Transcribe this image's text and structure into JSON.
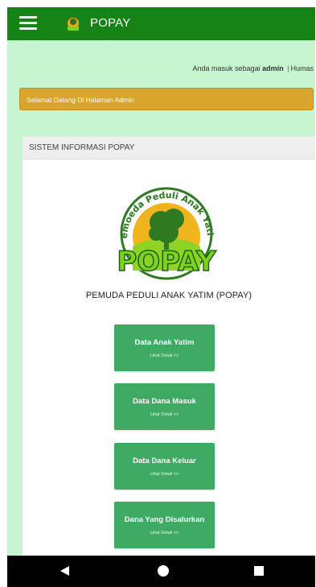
{
  "header": {
    "title": "POPAY",
    "menu_icon": "hamburger-icon",
    "logo_icon": "popay-logo-icon"
  },
  "login": {
    "prefix": "Anda masuk sebagai",
    "user": "admin",
    "separator": "|",
    "role": "Humas"
  },
  "alert": {
    "message": "Selamat Datang Di Halaman Admin"
  },
  "panel": {
    "heading": "SISTEM INFORMASI POPAY",
    "logo": {
      "arc_text": "Pemoeda Peduli Anak Yatim",
      "word": "POPAY"
    },
    "org_name": "PEMUDA PEDULI ANAK YATIM (POPAY)"
  },
  "menu": [
    {
      "title": "Data Anak Yatim",
      "link": "Lihat Detail >>"
    },
    {
      "title": "Data Dana Masuk",
      "link": "Lihat Detail >>"
    },
    {
      "title": "Data Dana Keluar",
      "link": "Lihat Detail >>"
    },
    {
      "title": "Dana Yang Disalurkan",
      "link": "Lihat Detail >>"
    }
  ],
  "colors": {
    "topbar": "#168316",
    "background": "#c7f5cf",
    "alert": "#d9a52c",
    "button": "#3eaa63"
  }
}
